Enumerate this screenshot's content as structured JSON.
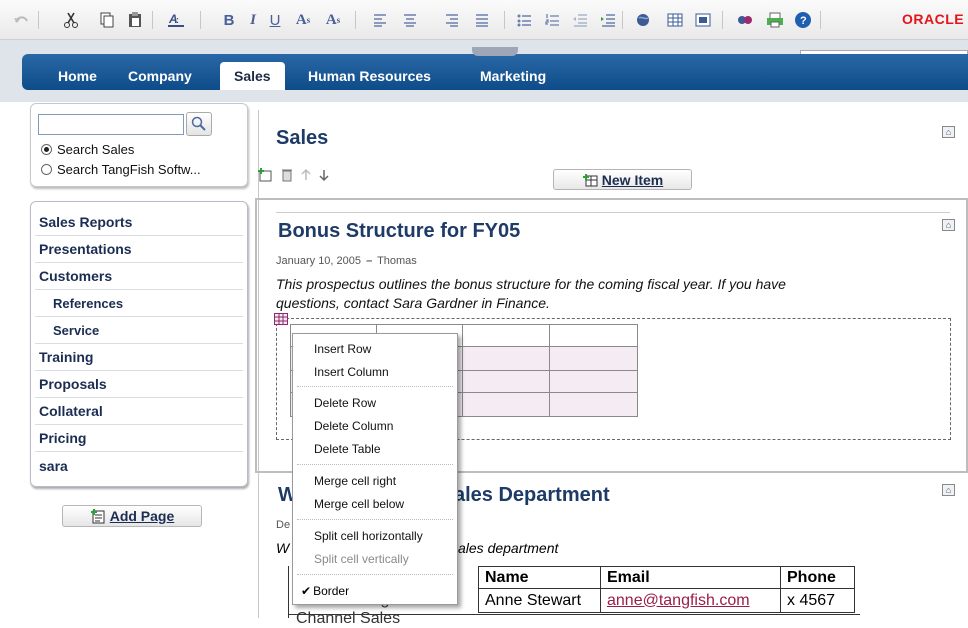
{
  "toolbar": {
    "icons": [
      "undo-icon",
      "cut-icon",
      "copy-icon",
      "paste-icon",
      "font-color-icon",
      "bold-icon",
      "italic-icon",
      "underline-icon",
      "superscript-icon",
      "subscript-icon",
      "align-left-icon",
      "align-center-icon",
      "align-right-icon",
      "justify-icon",
      "bullet-list-icon",
      "numbered-list-icon",
      "outdent-icon",
      "indent-icon",
      "link-icon",
      "table-icon",
      "image-icon",
      "spell-check-icon",
      "print-icon",
      "help-icon"
    ],
    "glyphs": {
      "bold": "B",
      "italic": "I",
      "underline": "U",
      "superscript": "A",
      "superscript_mark": "s",
      "subscript": "A",
      "subscript_mark": "s"
    },
    "brand": "ORACLE"
  },
  "nav": {
    "tabs": [
      "Home",
      "Company",
      "Sales",
      "Human Resources",
      "Marketing"
    ],
    "active": "Sales"
  },
  "search": {
    "input_value": "",
    "options": [
      "Search Sales",
      "Search TangFish Softw..."
    ],
    "selected": 0
  },
  "sidebar": {
    "items": [
      {
        "label": "Sales Reports",
        "sub": false
      },
      {
        "label": "Presentations",
        "sub": false
      },
      {
        "label": "Customers",
        "sub": false
      },
      {
        "label": "References",
        "sub": true
      },
      {
        "label": "Service",
        "sub": true
      },
      {
        "label": "Training",
        "sub": false
      },
      {
        "label": "Proposals",
        "sub": false
      },
      {
        "label": "Collateral",
        "sub": false
      },
      {
        "label": "Pricing",
        "sub": false
      },
      {
        "label": "sara",
        "sub": false
      }
    ],
    "add_page": "Add Page"
  },
  "page": {
    "title": "Sales",
    "new_item": "New Item"
  },
  "item1": {
    "title": "Bonus Structure for FY05",
    "date": "January 10, 2005",
    "dash": "–",
    "author": "Thomas",
    "body1": "This prospectus outlines the bonus structure for the coming fiscal year.  If you have",
    "body2": "questions, contact Sara Gardner in Finance."
  },
  "item2": {
    "title_left": "W",
    "title_right": "ales Department",
    "date_left": "De",
    "body_left": "W",
    "body_right": "ales department",
    "table": {
      "headers": [
        "Name",
        "Email",
        "Phone"
      ],
      "row": {
        "name": "Anne Stewart",
        "email": "anne@tangfish.com",
        "phone": "x 4567"
      },
      "cut_cell_top": "Sales Manager",
      "cut_cell_bottom": "Channel Sales"
    }
  },
  "context_menu": {
    "items": [
      "Insert Row",
      "Insert Column",
      "Delete Row",
      "Delete Column",
      "Delete Table",
      "Merge cell right",
      "Merge cell below",
      "Split cell horizontally",
      "Split cell vertically",
      "Border"
    ],
    "disabled": [
      "Split cell vertically"
    ],
    "checked": "Border",
    "check_glyph": "✔"
  },
  "colors": {
    "nav": "#1a5a98",
    "link": "#9b1d4a",
    "brand": "#e3141c",
    "title": "#1e3b67"
  }
}
